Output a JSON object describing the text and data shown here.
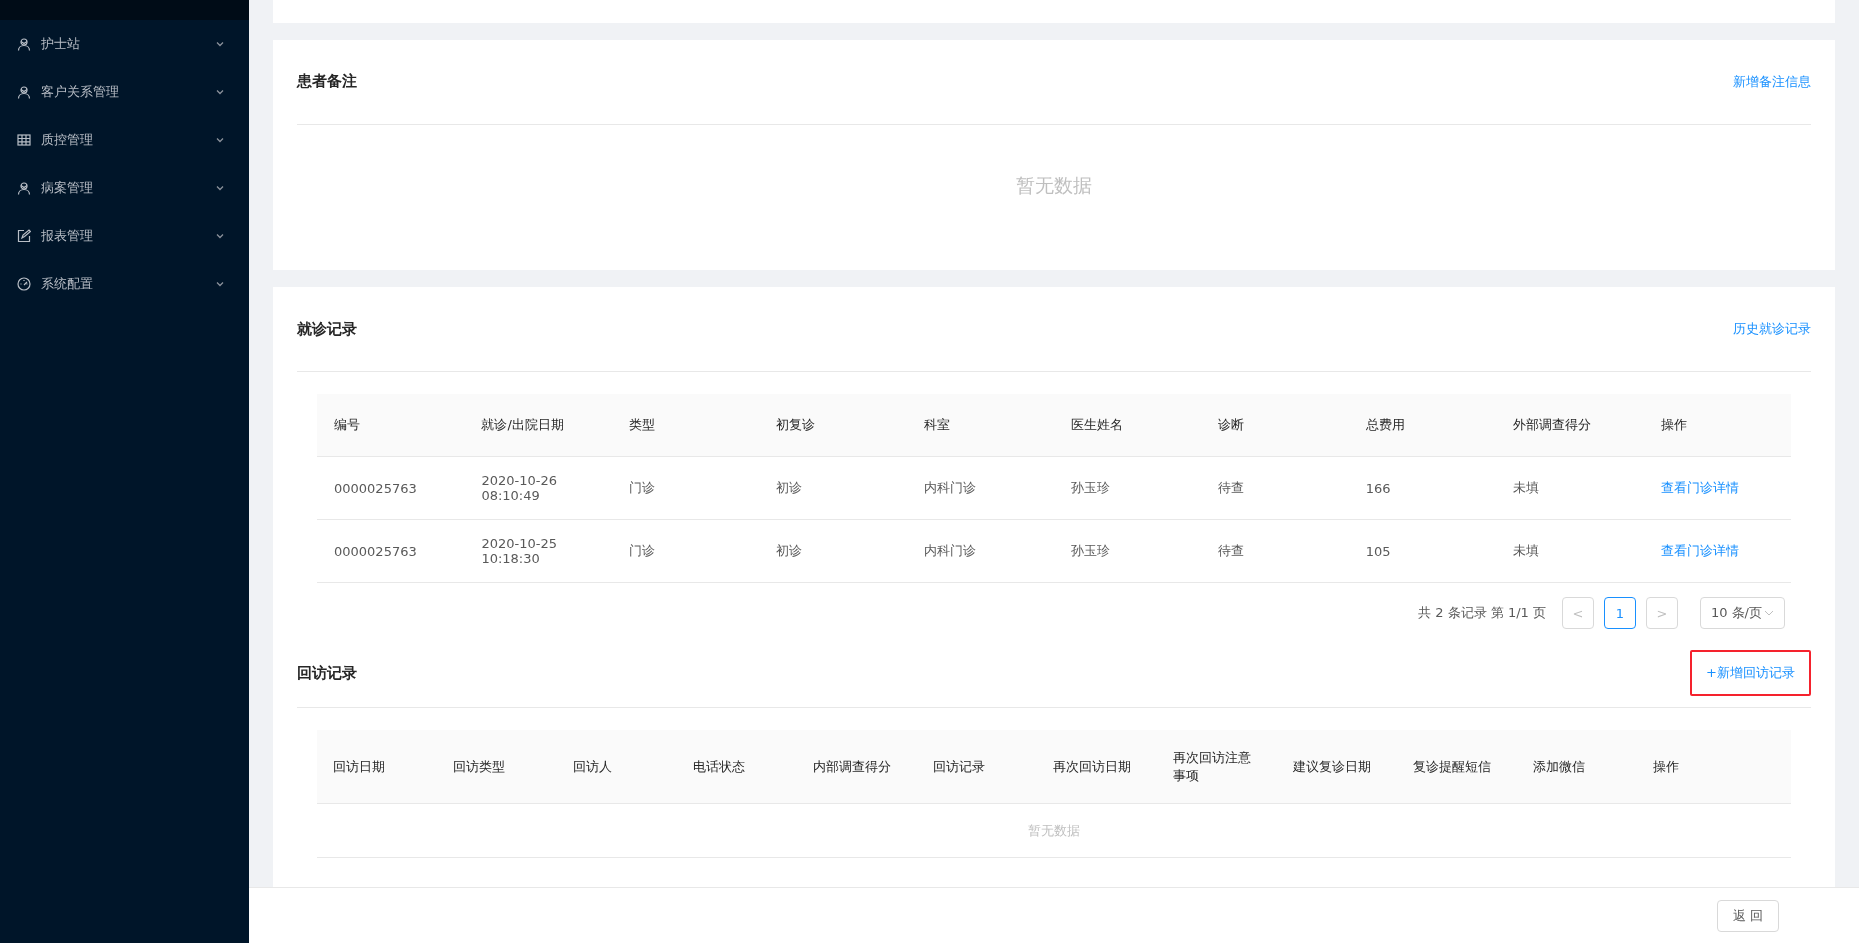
{
  "sidebar": {
    "items": [
      {
        "label": "护士站",
        "kind": "people"
      },
      {
        "label": "客户关系管理",
        "kind": "people"
      },
      {
        "label": "质控管理",
        "kind": "table"
      },
      {
        "label": "病案管理",
        "kind": "people"
      },
      {
        "label": "报表管理",
        "kind": "edit"
      },
      {
        "label": "系统配置",
        "kind": "gauge"
      }
    ]
  },
  "notes": {
    "title": "患者备注",
    "action": "新增备注信息",
    "empty": "暂无数据"
  },
  "visits": {
    "title": "就诊记录",
    "action": "历史就诊记录",
    "columns": [
      "编号",
      "就诊/出院日期",
      "类型",
      "初复诊",
      "科室",
      "医生姓名",
      "诊断",
      "总费用",
      "外部调查得分",
      "操作"
    ],
    "rows": [
      {
        "cells": [
          "0000025763",
          "2020-10-26 08:10:49",
          "门诊",
          "初诊",
          "内科门诊",
          "孙玉珍",
          "待查",
          "166",
          "未填"
        ],
        "link": "查看门诊详情"
      },
      {
        "cells": [
          "0000025763",
          "2020-10-25 10:18:30",
          "门诊",
          "初诊",
          "内科门诊",
          "孙玉珍",
          "待查",
          "105",
          "未填"
        ],
        "link": "查看门诊详情"
      }
    ],
    "pagination": {
      "summary": "共 2 条记录 第 1/1 页",
      "prev": "<",
      "pages": [
        {
          "label": "1",
          "selected": true
        }
      ],
      "next": ">",
      "page_size": "10 条/页"
    }
  },
  "followups": {
    "title": "回访记录",
    "action": "+新增回访记录",
    "action_highlighted": true,
    "columns": [
      "回访日期",
      "回访类型",
      "回访人",
      "电话状态",
      "内部调查得分",
      "回访记录",
      "再次回访日期",
      "再次回访注意事项",
      "建议复诊日期",
      "复诊提醒短信",
      "添加微信",
      "操作"
    ],
    "empty": "暂无数据"
  },
  "footer": {
    "button": "返 回"
  }
}
